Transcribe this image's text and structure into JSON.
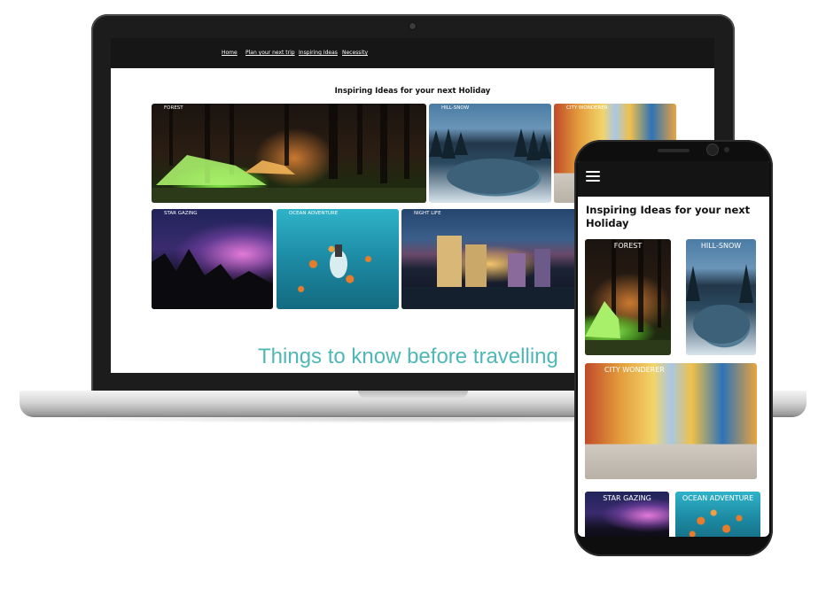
{
  "laptop": {
    "nav": {
      "items": [
        "Home",
        "Plan your next trip",
        "Inspiring Ideas",
        "Necessity"
      ]
    },
    "heading": "Inspiring Ideas for your next Holiday",
    "tiles": [
      {
        "caption": "FOREST"
      },
      {
        "caption": "HILL-SNOW"
      },
      {
        "caption": "CITY WONDERER"
      },
      {
        "caption": "STAR GAZING"
      },
      {
        "caption": "OCEAN ADVENTURE"
      },
      {
        "caption": "NIGHT LIFE"
      }
    ],
    "section_title": "Things to know before travelling"
  },
  "phone": {
    "menu_icon": "hamburger-menu-icon",
    "heading": "Inspiring Ideas for your next Holiday",
    "tiles": [
      {
        "caption": "FOREST"
      },
      {
        "caption": "HILL-SNOW"
      },
      {
        "caption": "CITY WONDERER"
      },
      {
        "caption": "STAR GAZING"
      },
      {
        "caption": "OCEAN ADVENTURE"
      }
    ]
  },
  "colors": {
    "nav_background": "#161616",
    "accent_teal": "#4fb8b6",
    "device_frame": "#0e0e0e"
  }
}
